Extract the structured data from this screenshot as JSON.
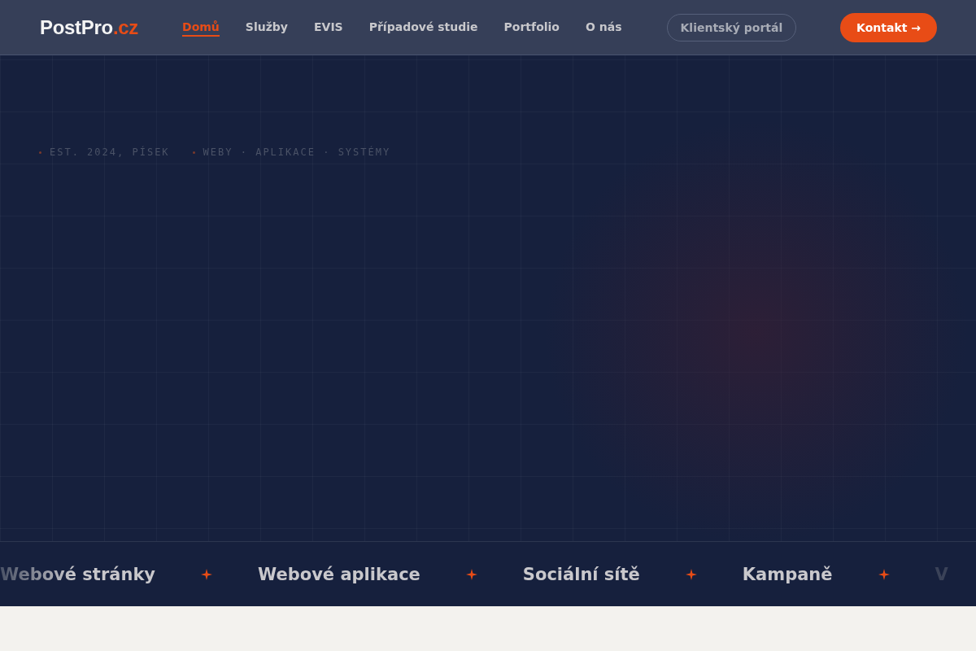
{
  "brand": {
    "name": "PostPro",
    "suffix": ".cz"
  },
  "nav": [
    {
      "label": "Domů",
      "selected": true
    },
    {
      "label": "Služby",
      "selected": false
    },
    {
      "label": "EVIS",
      "selected": false
    },
    {
      "label": "Případové studie",
      "selected": false
    },
    {
      "label": "Portfolio",
      "selected": false
    },
    {
      "label": "O nás",
      "selected": false
    }
  ],
  "portal_button": "Klientský portál",
  "contact_button": "Kontakt →",
  "hero": {
    "tags": [
      "EST. 2024, PÍSEK",
      "WEBY · APLIKACE · SYSTÉMY"
    ]
  },
  "marquee": [
    "Webové stránky",
    "Webové aplikace",
    "Sociální sítě",
    "Kampaně",
    "V"
  ]
}
